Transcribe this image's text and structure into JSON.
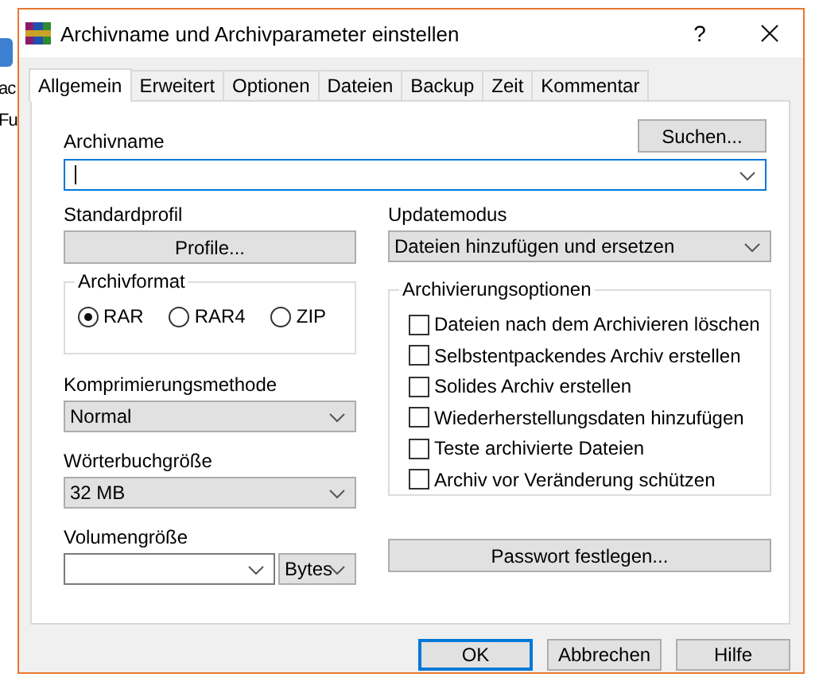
{
  "background_window": {
    "labels": [
      "ac",
      "Fu"
    ]
  },
  "window": {
    "title": "Archivname und Archivparameter einstellen",
    "help_button": "?"
  },
  "tabs": [
    {
      "label": "Allgemein",
      "selected": true
    },
    {
      "label": "Erweitert",
      "selected": false
    },
    {
      "label": "Optionen",
      "selected": false
    },
    {
      "label": "Dateien",
      "selected": false
    },
    {
      "label": "Backup",
      "selected": false
    },
    {
      "label": "Zeit",
      "selected": false
    },
    {
      "label": "Kommentar",
      "selected": false
    }
  ],
  "archive_name": {
    "label": "Archivname",
    "focused": true,
    "browse_button": "Suchen..."
  },
  "profile": {
    "label": "Standardprofil",
    "button": "Profile..."
  },
  "update_mode": {
    "label": "Updatemodus",
    "value": "Dateien hinzufügen und ersetzen"
  },
  "archive_format": {
    "label": "Archivformat",
    "options": [
      {
        "label": "RAR",
        "selected": true
      },
      {
        "label": "RAR4",
        "selected": false
      },
      {
        "label": "ZIP",
        "selected": false
      }
    ]
  },
  "compression_method": {
    "label": "Komprimierungsmethode",
    "value": "Normal"
  },
  "dictionary_size": {
    "label": "Wörterbuchgröße",
    "value": "32 MB"
  },
  "volume_size": {
    "label": "Volumengröße",
    "unit": "Bytes"
  },
  "archiving_options": {
    "label": "Archivierungsoptionen",
    "options": [
      {
        "label": "Dateien nach dem Archivieren löschen",
        "checked": false
      },
      {
        "label": "Selbstentpackendes Archiv erstellen",
        "checked": false
      },
      {
        "label": "Solides Archiv erstellen",
        "checked": false
      },
      {
        "label": "Wiederherstellungsdaten hinzufügen",
        "checked": false
      },
      {
        "label": "Teste archivierte Dateien",
        "checked": false
      },
      {
        "label": "Archiv vor Veränderung schützen",
        "checked": false
      }
    ]
  },
  "password_button": "Passwort festlegen...",
  "buttons": [
    {
      "label": "OK",
      "default": true
    },
    {
      "label": "Abbrechen",
      "default": false
    },
    {
      "label": "Hilfe",
      "default": false
    }
  ]
}
